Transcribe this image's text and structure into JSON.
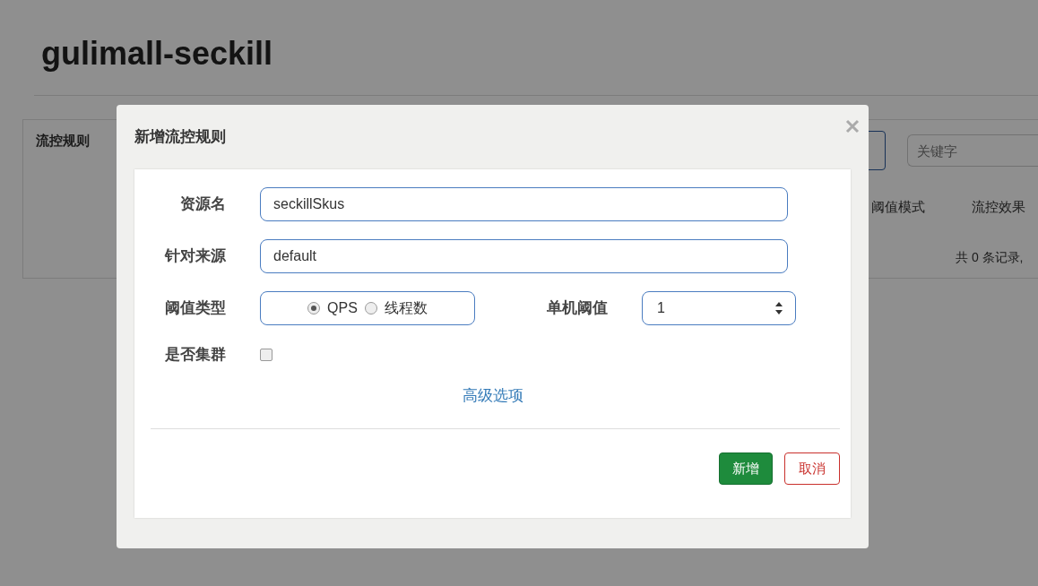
{
  "page": {
    "title": "gulimall-seckill",
    "panel_title": "流控规则",
    "search": {
      "placeholder": "关键字"
    },
    "columns": [
      "阈值模式",
      "流控效果"
    ],
    "footer": "共 0 条记录,"
  },
  "dialog": {
    "title": "新增流控规则",
    "fields": [
      {
        "label": "资源名",
        "value": "seckillSkus"
      },
      {
        "label": "针对来源",
        "value": "default"
      }
    ],
    "threshold_type": {
      "label": "阈值类型",
      "options": [
        {
          "label": "QPS",
          "selected": true
        },
        {
          "label": "线程数",
          "selected": false
        }
      ]
    },
    "threshold": {
      "label": "单机阈值",
      "value": "1"
    },
    "cluster": {
      "label": "是否集群",
      "checked": false
    },
    "advanced_link": "高级选项",
    "buttons": [
      {
        "kind": "primary",
        "label": "新增"
      },
      {
        "kind": "cancel",
        "label": "取消"
      }
    ]
  }
}
